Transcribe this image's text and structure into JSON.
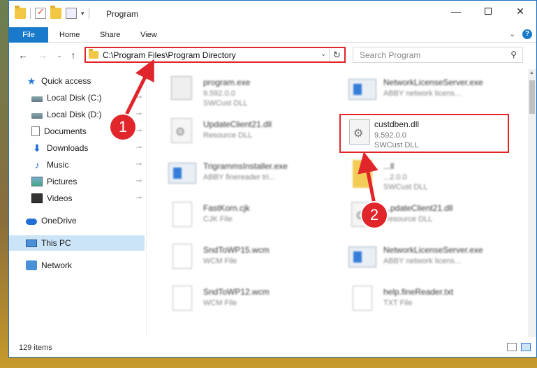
{
  "window": {
    "title": "Program",
    "controls": {
      "minimize": "—",
      "close": "✕"
    }
  },
  "ribbon": {
    "tabs": [
      "File",
      "Home",
      "Share",
      "View"
    ],
    "collapse_glyph": "⌄",
    "help_glyph": "?"
  },
  "nav": {
    "back_glyph": "←",
    "forward_glyph": "→",
    "recent_glyph": "⌄",
    "up_glyph": "↑",
    "address_path": "C:\\Program Files\\Program Directory",
    "address_drop_glyph": "⌄",
    "refresh_glyph": "↻",
    "search_placeholder": "Search Program",
    "search_glyph": "⚲"
  },
  "sidebar": {
    "items": [
      {
        "label": "Quick access",
        "icon": "star-icon",
        "pinned": false
      },
      {
        "label": "Local Disk (C:)",
        "icon": "disk-icon",
        "pinned": true
      },
      {
        "label": "Local Disk (D:)",
        "icon": "disk-icon",
        "pinned": true
      },
      {
        "label": "Documents",
        "icon": "documents-icon",
        "pinned": true
      },
      {
        "label": "Downloads",
        "icon": "downloads-icon",
        "pinned": true
      },
      {
        "label": "Music",
        "icon": "music-icon",
        "pinned": true
      },
      {
        "label": "Pictures",
        "icon": "pictures-icon",
        "pinned": true
      },
      {
        "label": "Videos",
        "icon": "videos-icon",
        "pinned": true
      },
      {
        "label": "OneDrive",
        "icon": "cloud-icon",
        "pinned": false
      },
      {
        "label": "This PC",
        "icon": "pc-icon",
        "pinned": false,
        "selected": true
      },
      {
        "label": "Network",
        "icon": "network-icon",
        "pinned": false
      }
    ],
    "pin_glyph": "📌"
  },
  "files": [
    {
      "name": "program.exe",
      "meta1": "9.592.0.0",
      "meta2": "SWCust DLL",
      "icon": "exe-icon"
    },
    {
      "name": "NetworkLicenseServer.exe",
      "meta1": "ABBY network licens...",
      "meta2": "",
      "icon": "app-icon"
    },
    {
      "name": "UpdateClient21.dll",
      "meta1": "Resource DLL",
      "meta2": "",
      "icon": "dll-icon"
    },
    {
      "name": "custdben.dll",
      "meta1": "9.592.0.0",
      "meta2": "SWCust DLL",
      "icon": "dll-icon",
      "highlighted": true
    },
    {
      "name": "TrigrammsInstaller.exe",
      "meta1": "ABBY finereader tri...",
      "meta2": "",
      "icon": "app-icon"
    },
    {
      "name": "...ll",
      "meta1": "...2.0.0",
      "meta2": "SWCust DLL",
      "icon": "zip-icon"
    },
    {
      "name": "FastKorn.cjk",
      "meta1": "CJK File",
      "meta2": "",
      "icon": "doc-icon"
    },
    {
      "name": "...pdateClient21.dll",
      "meta1": "Resource DLL",
      "meta2": "",
      "icon": "dll-icon"
    },
    {
      "name": "SndToWP15.wcm",
      "meta1": "WCM File",
      "meta2": "",
      "icon": "doc-icon"
    },
    {
      "name": "NetworkLicenseServer.exe",
      "meta1": "ABBY network licens...",
      "meta2": "",
      "icon": "app-icon"
    },
    {
      "name": "SndToWP12.wcm",
      "meta1": "WCM File",
      "meta2": "",
      "icon": "doc-icon"
    },
    {
      "name": "help.fineReader.txt",
      "meta1": "TXT File",
      "meta2": "",
      "icon": "doc-icon"
    }
  ],
  "status": {
    "item_count": "129 items"
  },
  "annotations": {
    "callout_1": "1",
    "callout_2": "2",
    "accent": "#e0252b"
  }
}
